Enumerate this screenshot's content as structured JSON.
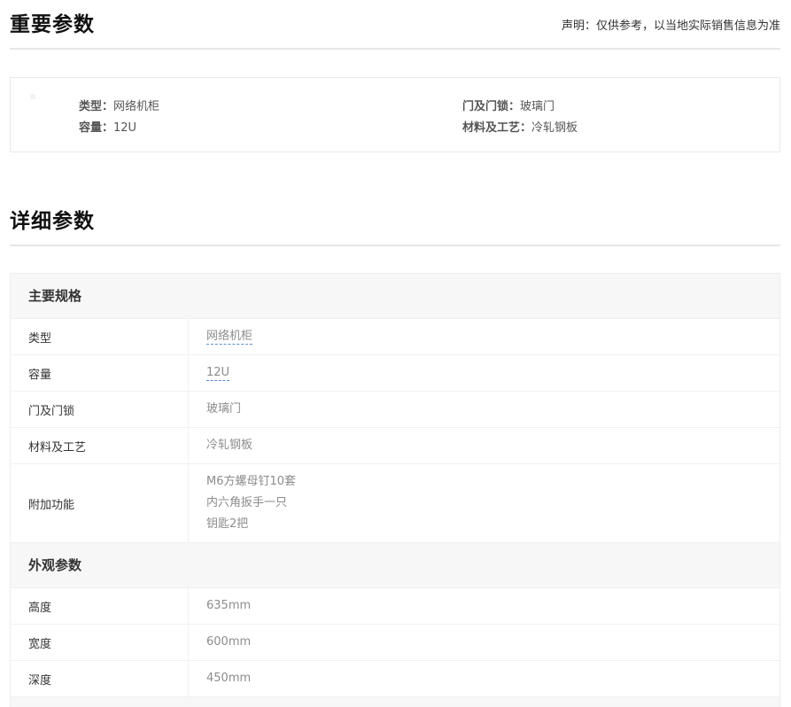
{
  "important": {
    "title": "重要参数",
    "disclaimer": "声明：仅供参考，以当地实际销售信息为准",
    "items": [
      {
        "key": "类型：",
        "value": "网络机柜"
      },
      {
        "key": "容量：",
        "value": "12U"
      },
      {
        "key": "门及门锁：",
        "value": "玻璃门"
      },
      {
        "key": "材料及工艺：",
        "value": "冷轧钢板"
      }
    ]
  },
  "detail": {
    "title": "详细参数",
    "groups": [
      {
        "title": "主要规格",
        "rows": [
          {
            "key": "类型",
            "values": [
              "网络机柜"
            ],
            "link": true
          },
          {
            "key": "容量",
            "values": [
              "12U"
            ],
            "link": true
          },
          {
            "key": "门及门锁",
            "values": [
              "玻璃门"
            ]
          },
          {
            "key": "材料及工艺",
            "values": [
              "冷轧钢板"
            ]
          },
          {
            "key": "附加功能",
            "values": [
              "M6方螺母钉10套",
              "内六角扳手一只",
              "钥匙2把"
            ]
          }
        ]
      },
      {
        "title": "外观参数",
        "rows": [
          {
            "key": "高度",
            "values": [
              "635mm"
            ]
          },
          {
            "key": "宽度",
            "values": [
              "600mm"
            ]
          },
          {
            "key": "深度",
            "values": [
              "450mm"
            ]
          }
        ]
      }
    ]
  }
}
